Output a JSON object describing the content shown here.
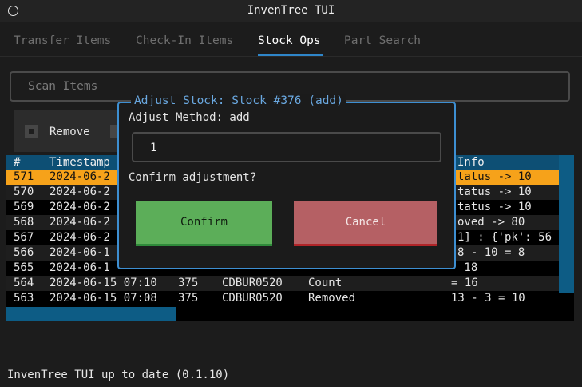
{
  "window": {
    "title": "InvenTree TUI"
  },
  "tabs": [
    {
      "label": "Transfer Items",
      "active": false
    },
    {
      "label": "Check-In Items",
      "active": false
    },
    {
      "label": "Stock Ops",
      "active": true
    },
    {
      "label": "Part Search",
      "active": false
    }
  ],
  "scan": {
    "placeholder": "Scan Items"
  },
  "controls": {
    "remove_label": "Remove"
  },
  "table": {
    "headers": [
      "#",
      "Timestamp",
      "Info"
    ],
    "rows": [
      {
        "id": "571",
        "ts": "2024-06-2",
        "info": "tatus -> 10",
        "style": "highlighted"
      },
      {
        "id": "570",
        "ts": "2024-06-2",
        "info": "tatus -> 10",
        "style": "dark"
      },
      {
        "id": "569",
        "ts": "2024-06-2",
        "info": "tatus -> 10",
        "style": "black"
      },
      {
        "id": "568",
        "ts": "2024-06-2",
        "info": "oved -> 80",
        "style": "dark"
      },
      {
        "id": "567",
        "ts": "2024-06-2",
        "info": "1] : {'pk': 56",
        "style": "black"
      },
      {
        "id": "566",
        "ts": "2024-06-1",
        "info": "8 - 10 = 8",
        "style": "dark"
      },
      {
        "id": "565",
        "ts": "2024-06-1",
        "info": " 18",
        "style": "black"
      },
      {
        "id": "564",
        "ts": "2024-06-15 07:10",
        "qty": "375",
        "part": "CDBUR0520",
        "action": "Count",
        "info": "= 16",
        "style": "dark"
      },
      {
        "id": "563",
        "ts": "2024-06-15 07:08",
        "qty": "375",
        "part": "CDBUR0520",
        "action": "Removed",
        "info": "13 - 3 = 10",
        "style": "black"
      }
    ]
  },
  "dialog": {
    "title": "Adjust Stock: Stock #376 (add)",
    "method_label": "Adjust Method: add",
    "amount_value": "1",
    "question": "Confirm adjustment?",
    "confirm_label": "Confirm",
    "cancel_label": "Cancel"
  },
  "status": {
    "footer": "InvenTree TUI up to date (0.1.10)"
  },
  "colors": {
    "accent": "#3d8fd2",
    "highlight": "#f6a21a",
    "confirm": "#5cae59",
    "cancel": "#b56064",
    "table_header": "#0d4f74"
  },
  "icons": {
    "window": "circle-icon",
    "checkbox": "checkbox-icon"
  }
}
